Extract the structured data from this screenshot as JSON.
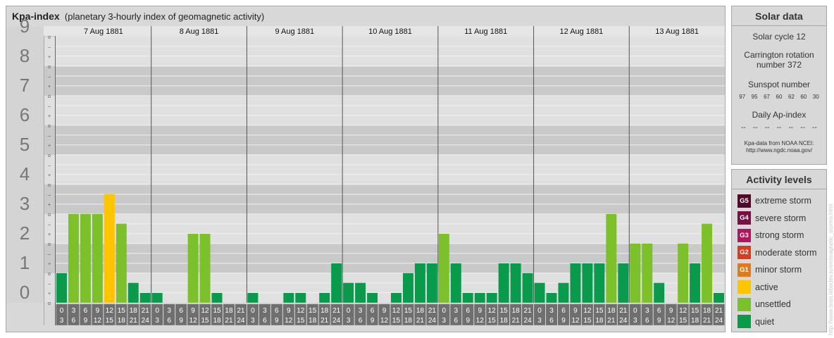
{
  "header": {
    "title": "Kpa-index",
    "subtitle": "(planetary 3-hourly index of geomagnetic activity)"
  },
  "chart_data": {
    "type": "bar",
    "ylim": [
      0,
      9.33
    ],
    "y_ticks": [
      "0",
      "1",
      "2",
      "3",
      "4",
      "5",
      "6",
      "7",
      "8",
      "9"
    ],
    "minor_tick_labels": [
      "o",
      "+",
      "–"
    ],
    "x_hour_ranges": [
      [
        "0",
        "3"
      ],
      [
        "3",
        "6"
      ],
      [
        "6",
        "9"
      ],
      [
        "9",
        "12"
      ],
      [
        "12",
        "15"
      ],
      [
        "15",
        "18"
      ],
      [
        "18",
        "21"
      ],
      [
        "21",
        "24"
      ]
    ],
    "days": [
      {
        "date": "7 Aug 1881",
        "values": [
          1.0,
          3.0,
          3.0,
          3.0,
          3.67,
          2.67,
          0.67,
          0.33
        ]
      },
      {
        "date": "8 Aug 1881",
        "values": [
          0.33,
          0.0,
          0.0,
          2.33,
          2.33,
          0.33,
          0.0,
          0.0
        ]
      },
      {
        "date": "9 Aug 1881",
        "values": [
          0.33,
          0.0,
          0.0,
          0.33,
          0.33,
          0.0,
          0.33,
          1.33
        ]
      },
      {
        "date": "10 Aug 1881",
        "values": [
          0.67,
          0.67,
          0.33,
          0.0,
          0.33,
          1.0,
          1.33,
          1.33
        ]
      },
      {
        "date": "11 Aug 1881",
        "values": [
          2.33,
          1.33,
          0.33,
          0.33,
          0.33,
          1.33,
          1.33,
          1.0
        ]
      },
      {
        "date": "12 Aug 1881",
        "values": [
          0.67,
          0.33,
          0.67,
          1.33,
          1.33,
          1.33,
          3.0,
          1.33
        ]
      },
      {
        "date": "13 Aug 1881",
        "values": [
          2.0,
          2.0,
          0.67,
          0.0,
          2.0,
          1.33,
          2.67,
          0.33
        ]
      }
    ],
    "colors": {
      "quiet": "#0a9a4b",
      "unsettled": "#7cc12b",
      "active": "#ffc600",
      "minor": "#e07a1f",
      "moderate": "#d83c1e",
      "strong": "#b0165d",
      "severe": "#7a0f44",
      "extreme": "#4f0a2a"
    }
  },
  "solar": {
    "title": "Solar data",
    "cycle": "Solar cycle 12",
    "rotation_line1": "Carrington rotation",
    "rotation_line2": "number 372",
    "sunspot_title": "Sunspot number",
    "sunspots": [
      "97",
      "95",
      "67",
      "60",
      "62",
      "60",
      "30"
    ],
    "ap_title": "Daily Ap-index",
    "ap_values": [
      "--",
      "--",
      "--",
      "--",
      "--",
      "--",
      "--"
    ],
    "source_line1": "Kpa-data from NOAA NCEI:",
    "source_line2": "http://www.ngdc.noaa.gov/"
  },
  "levels": {
    "title": "Activity levels",
    "items": [
      {
        "code": "G5",
        "label": "extreme storm",
        "color": "#4f0a2a"
      },
      {
        "code": "G4",
        "label": "severe storm",
        "color": "#7a0f44"
      },
      {
        "code": "G3",
        "label": "strong storm",
        "color": "#b0165d"
      },
      {
        "code": "G2",
        "label": "moderate storm",
        "color": "#d83c1e"
      },
      {
        "code": "G1",
        "label": "minor storm",
        "color": "#e07a1f"
      },
      {
        "code": "",
        "label": "active",
        "color": "#ffc600"
      },
      {
        "code": "",
        "label": "unsettled",
        "color": "#7cc12b"
      },
      {
        "code": "",
        "label": "quiet",
        "color": "#0a9a4b"
      }
    ]
  },
  "credit": "http://www.tesis.lebedev.ru/en/magnetic_storms.html"
}
